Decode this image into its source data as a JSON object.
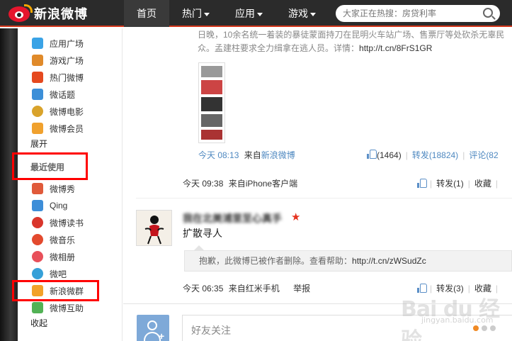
{
  "header": {
    "logo_text": "新浪微博",
    "nav": [
      {
        "label": "首页",
        "has_caret": false
      },
      {
        "label": "热门",
        "has_caret": true
      },
      {
        "label": "应用",
        "has_caret": true
      },
      {
        "label": "游戏",
        "has_caret": true
      }
    ],
    "search_placeholder": "大家正在热搜：房贷利率"
  },
  "sidebar": {
    "top_items": [
      {
        "label": "应用广场",
        "icon": "app-square-icon",
        "color": "#3aa3e6"
      },
      {
        "label": "游戏广场",
        "icon": "game-square-icon",
        "color": "#e08a2a"
      },
      {
        "label": "热门微博",
        "icon": "hot-weibo-icon",
        "color": "#e5491f"
      },
      {
        "label": "微话题",
        "icon": "topic-icon",
        "color": "#3c8fd8"
      },
      {
        "label": "微博电影",
        "icon": "movie-icon",
        "color": "#d9a32b"
      },
      {
        "label": "微博会员",
        "icon": "vip-icon",
        "color": "#f0a12e"
      }
    ],
    "expand_label": "展开",
    "recent_heading": "最近使用",
    "recent_items": [
      {
        "label": "微博秀",
        "icon": "weibo-show-icon",
        "color": "#e05a3a"
      },
      {
        "label": "Qing",
        "icon": "qing-icon",
        "color": "#3d8ed8"
      },
      {
        "label": "微博读书",
        "icon": "weibo-book-icon",
        "color": "#d9352b"
      },
      {
        "label": "微音乐",
        "icon": "music-icon",
        "color": "#e34a2e"
      },
      {
        "label": "微相册",
        "icon": "photo-album-icon",
        "color": "#e8505a"
      },
      {
        "label": "微吧",
        "icon": "weiba-icon",
        "color": "#36a0d8"
      },
      {
        "label": "新浪微群",
        "icon": "weiqun-icon",
        "color": "#f2a22a"
      },
      {
        "label": "微博互助",
        "icon": "help-icon",
        "color": "#52b255"
      }
    ],
    "collapse_label": "收起"
  },
  "feed": {
    "post1": {
      "text_line1": "日晚，10余名统一着装的暴徒蒙面持刀在昆明火车站广场、售票厅等处砍杀无辜民",
      "text_line2_prefix": "众。孟建柱要求全力缉拿在逃人员。详情：",
      "link": "http://t.cn/8FrS1GR",
      "time": "今天 08:13",
      "from_label": "来自",
      "source": "新浪微博",
      "likes": "(1464)",
      "repost": "转发(18824)",
      "comment": "评论(82"
    },
    "post1_footer": {
      "time": "今天 09:38",
      "source": "来自iPhone客户端",
      "repost": "转发(1)",
      "favorite": "收藏"
    },
    "post2": {
      "user_name": "我在北美浦里至心真手",
      "text": "扩散寻人",
      "quote_text": "抱歉，此微博已被作者删除。查看帮助：",
      "quote_link": "http://t.cn/zWSudZc"
    },
    "post2_footer": {
      "time": "今天 06:35",
      "source": "来自红米手机",
      "report": "举报",
      "repost": "转发(3)",
      "favorite": "收藏"
    },
    "friend_panel": {
      "placeholder": "好友关注"
    }
  },
  "watermark": {
    "brand": "Bai du 经验",
    "url": "jingyan.baidu.com"
  }
}
